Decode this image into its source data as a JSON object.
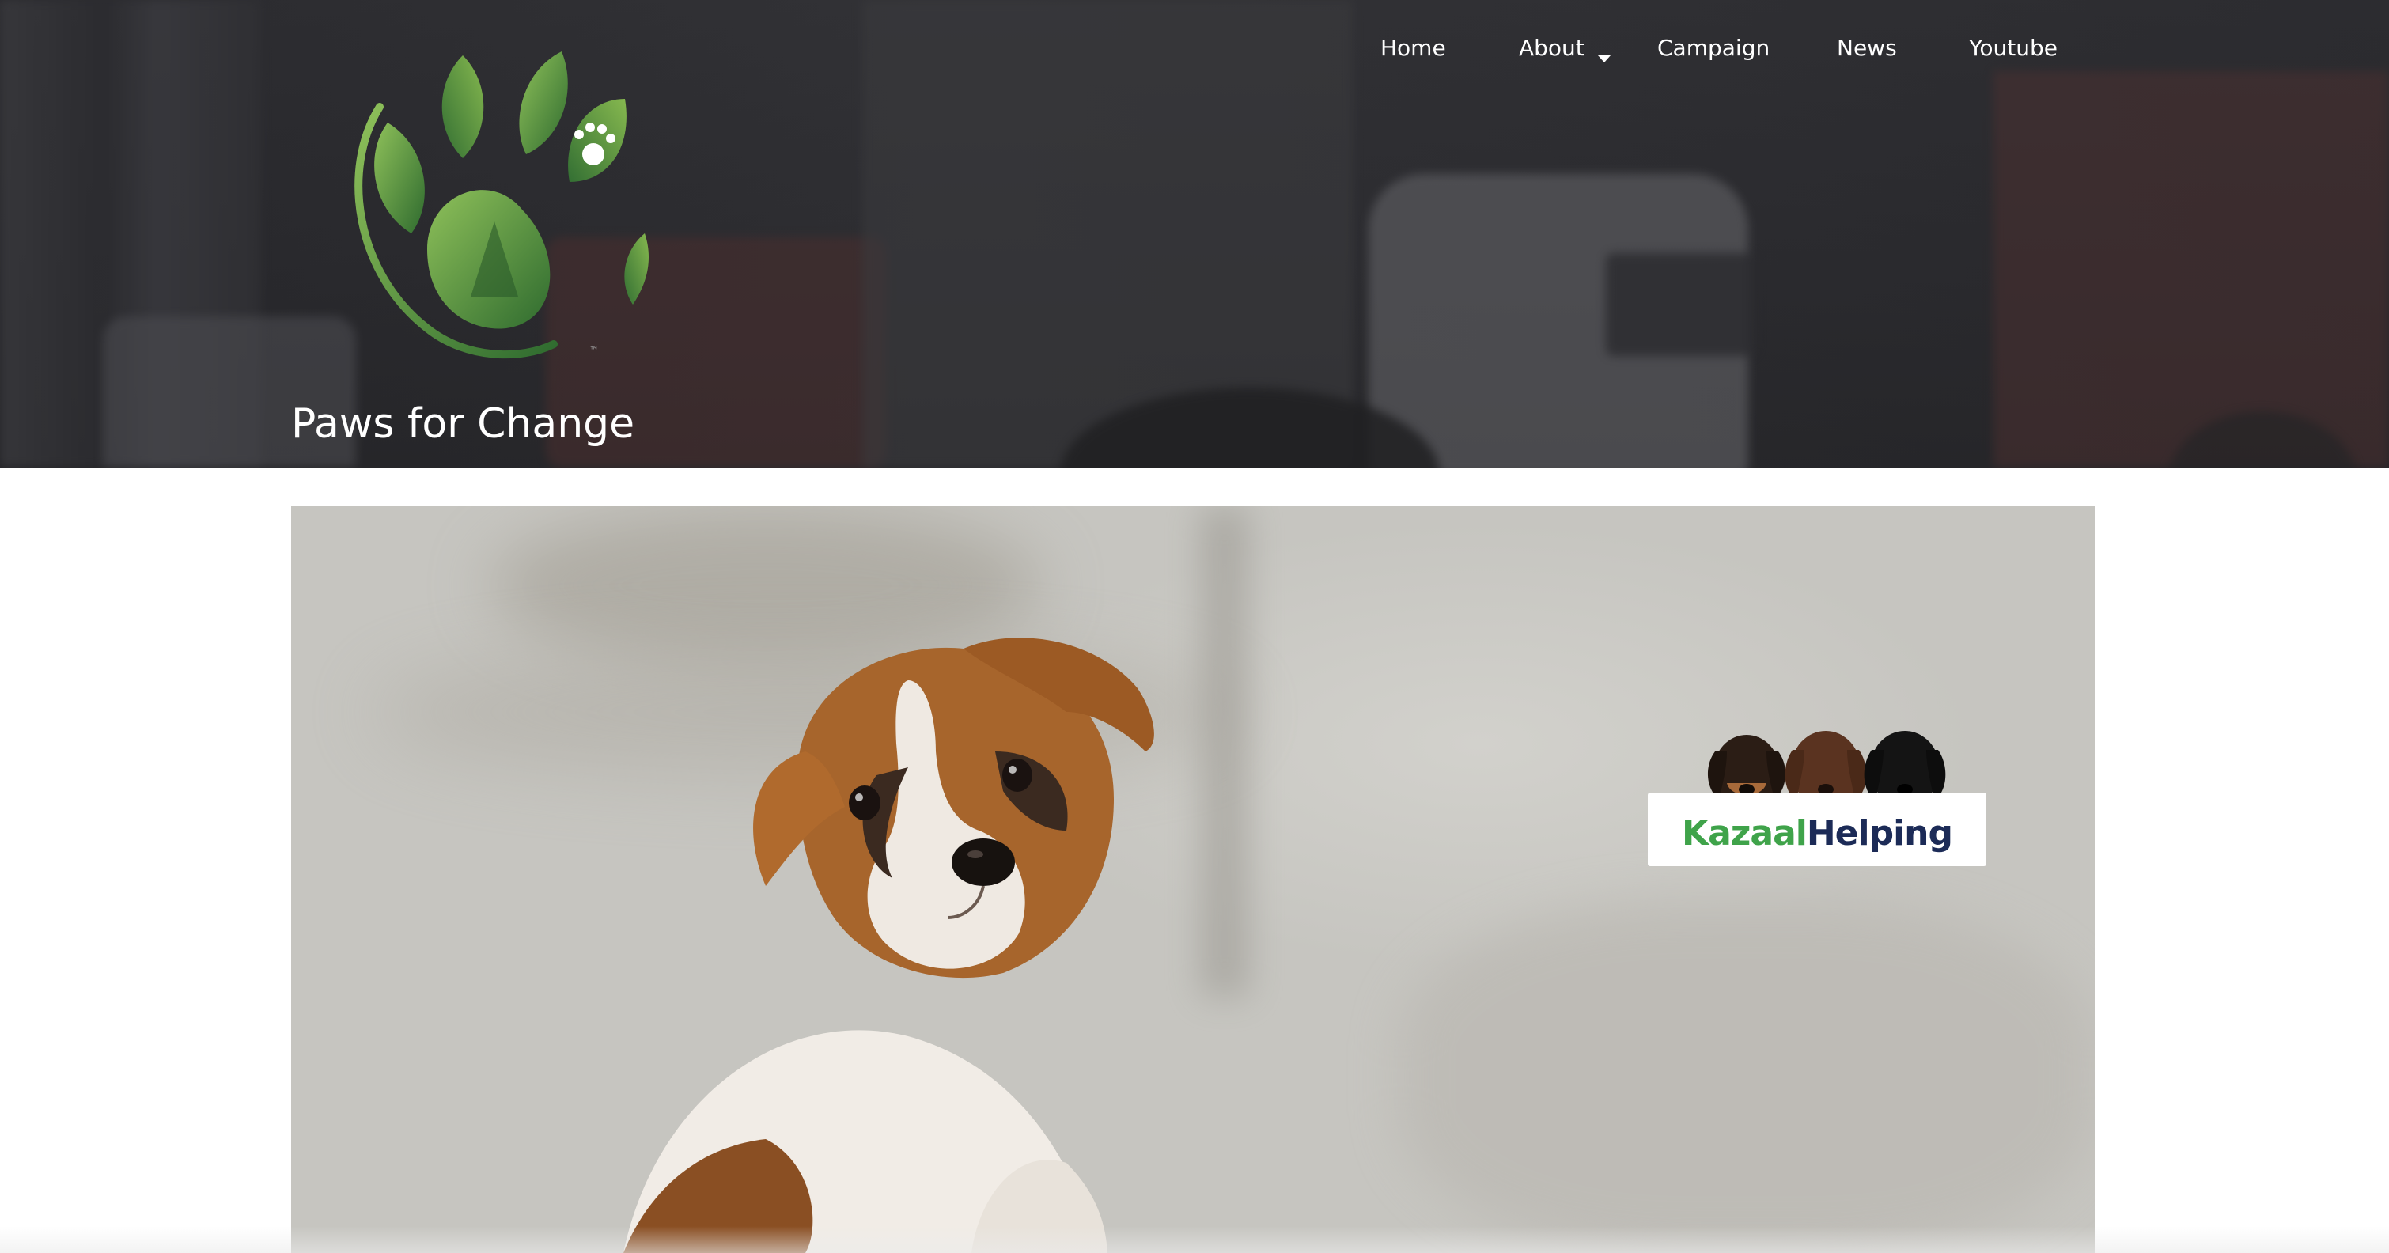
{
  "site": {
    "title": "Paws for Change",
    "logo_icon": "paw-leaf-logo",
    "trademark": "™"
  },
  "nav": {
    "items": [
      {
        "label": "Home"
      },
      {
        "label": "About",
        "has_dropdown": true
      },
      {
        "label": "Campaign"
      },
      {
        "label": "News"
      },
      {
        "label": "Youtube"
      }
    ]
  },
  "hero": {
    "badge": {
      "brand_part1": "Kazaal",
      "brand_part2": "Helping",
      "colors": {
        "part1": "#3fa34a",
        "part2": "#1c2b57"
      }
    }
  },
  "colors": {
    "header_overlay": "#2d2d31",
    "nav_text": "#ffffff",
    "logo_green_dark": "#2f6b2f",
    "logo_green_light": "#7fb24a"
  }
}
